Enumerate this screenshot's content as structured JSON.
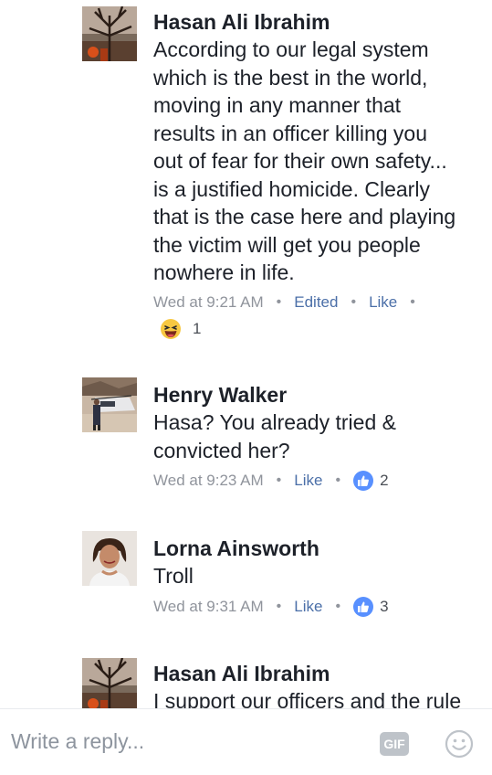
{
  "comments": [
    {
      "author": "Hasan Ali Ibrahim",
      "text": "According to our legal system\nwhich is the best in the world,\nmoving in any manner that\nresults in an officer killing you\nout of fear for their own safety...\nis a justified homicide. Clearly\nthat is the case here and playing\nthe victim will get you people\nnowhere in life.",
      "time": "Wed at 9:21 AM",
      "edited": "Edited",
      "like": "Like",
      "reaction_icon": "haha-emoji-icon",
      "reaction_count": "1"
    },
    {
      "author": "Henry Walker",
      "text": "Hasa? You already tried &\nconvicted her?",
      "time": "Wed at 9:23 AM",
      "like": "Like",
      "reaction_icon": "thumbs-up-icon",
      "reaction_count": "2"
    },
    {
      "author": "Lorna Ainsworth",
      "text": "Troll",
      "time": "Wed at 9:31 AM",
      "like": "Like",
      "reaction_icon": "thumbs-up-icon",
      "reaction_count": "3"
    },
    {
      "author": "Hasan Ali Ibrahim",
      "text": "I support our officers and the rule"
    }
  ],
  "composer": {
    "placeholder": "Write a reply...",
    "gif_label": "GIF",
    "emoji_icon": "smiley-icon"
  },
  "colors": {
    "link": "#4b6fa8",
    "meta": "#90949c",
    "like_blue": "#5890ff"
  }
}
